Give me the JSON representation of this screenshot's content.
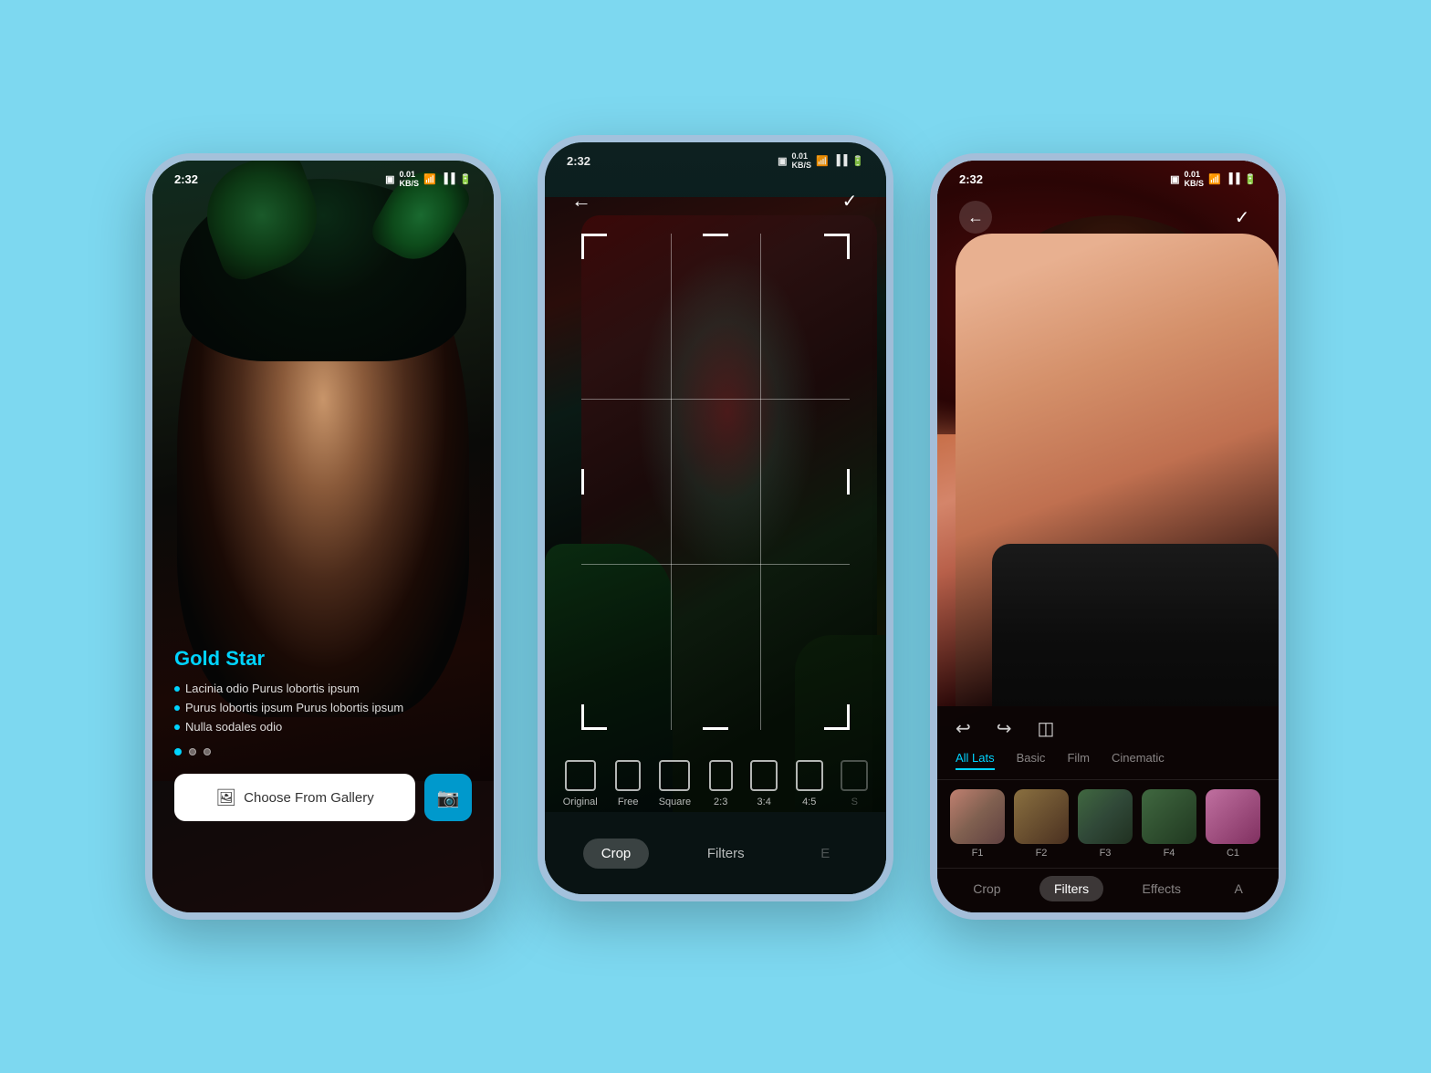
{
  "background": "#7dd8f0",
  "phone1": {
    "time": "2:32",
    "title": "Gold Star",
    "bullets": [
      "Lacinia odio Purus lobortis ipsum",
      "Purus lobortis ipsum Purus lobortis ipsum",
      "Nulla sodales odio"
    ],
    "dots": [
      "active",
      "inactive",
      "inactive"
    ],
    "gallery_button": "Choose From Gallery",
    "gallery_icon": "🖼",
    "camera_icon": "📷"
  },
  "phone2": {
    "time": "2:32",
    "back_icon": "←",
    "check_icon": "✓",
    "ratios": [
      {
        "label": "Original",
        "key": "original"
      },
      {
        "label": "Free",
        "key": "free"
      },
      {
        "label": "Square",
        "key": "square"
      },
      {
        "label": "2:3",
        "key": "23"
      },
      {
        "label": "3:4",
        "key": "34"
      },
      {
        "label": "4:5",
        "key": "45"
      }
    ],
    "tabs": [
      {
        "label": "Crop",
        "active": true
      },
      {
        "label": "Filters",
        "active": false
      },
      {
        "label": "E",
        "active": false
      }
    ]
  },
  "phone3": {
    "time": "2:32",
    "back_icon": "←",
    "check_icon": "✓",
    "tool_undo": "↩",
    "tool_redo": "↪",
    "tool_adjust": "◫",
    "filter_tabs": [
      {
        "label": "All Lats",
        "active": true
      },
      {
        "label": "Basic",
        "active": false
      },
      {
        "label": "Film",
        "active": false
      },
      {
        "label": "Cinematic",
        "active": false
      }
    ],
    "filters": [
      {
        "label": "F1",
        "style": "ft-f1"
      },
      {
        "label": "F2",
        "style": "ft-f2"
      },
      {
        "label": "F3",
        "style": "ft-f3"
      },
      {
        "label": "F4",
        "style": "ft-f4"
      },
      {
        "label": "C1",
        "style": "ft-c1"
      }
    ],
    "bottom_tabs": [
      {
        "label": "Crop",
        "active": false
      },
      {
        "label": "Filters",
        "active": true
      },
      {
        "label": "Effects",
        "active": false
      },
      {
        "label": "A",
        "active": false
      }
    ]
  }
}
